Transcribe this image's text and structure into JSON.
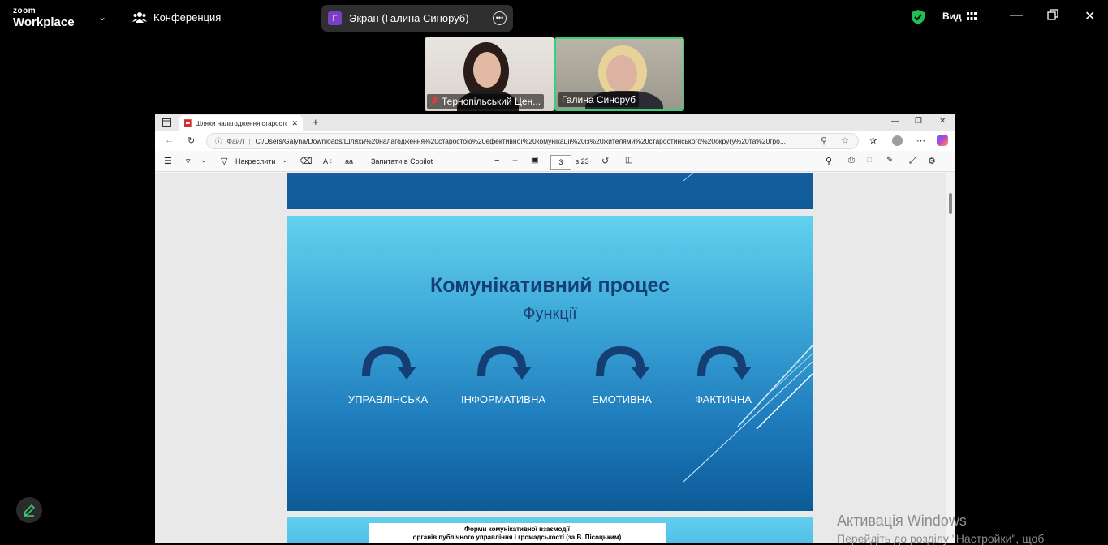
{
  "zoom": {
    "logo_top": "zoom",
    "logo_bottom": "Workplace",
    "meeting_label": "Конференция",
    "share_initial": "Г",
    "share_label": "Экран (Галина Синоруб)",
    "view_label": "Вид"
  },
  "participants": [
    {
      "name": "Тернопільський Цен..."
    },
    {
      "name": "Галина Синоруб"
    }
  ],
  "browser": {
    "tab_title": "Шляхи налагодження старостою",
    "address_prefix": "Файл",
    "address": "C:/Users/Galyna/Downloads/Шляхи%20налагодження%20старостою%20ефективної%20комунікації%20із%20жителями%20старостинського%20округу%20та%20гро..."
  },
  "pdf_toolbar": {
    "draw_label": "Накреслити",
    "copilot_label": "Запитати в Copilot",
    "page_current": "3",
    "page_total": "з 23"
  },
  "slide": {
    "title": "Комунікативний процес",
    "subtitle": "Функції",
    "functions": [
      "УПРАВЛІНСЬКА",
      "ІНФОРМАТИВНА",
      "ЕМОТИВНА",
      "ФАКТИЧНА"
    ]
  },
  "next_slide": {
    "line1": "Форми комунікативної взаємодії",
    "line2": "органів публічного управління і громадськості (за В. Пісоцьким)"
  },
  "watermark": {
    "line1": "Активація Windows",
    "line2": "Перейдіть до розділу \"Настройки\", щоб"
  },
  "colors": {
    "speaker_border": "#3ad07a",
    "slide_title": "#143e74",
    "share_avatar": "#7b3fc7"
  }
}
